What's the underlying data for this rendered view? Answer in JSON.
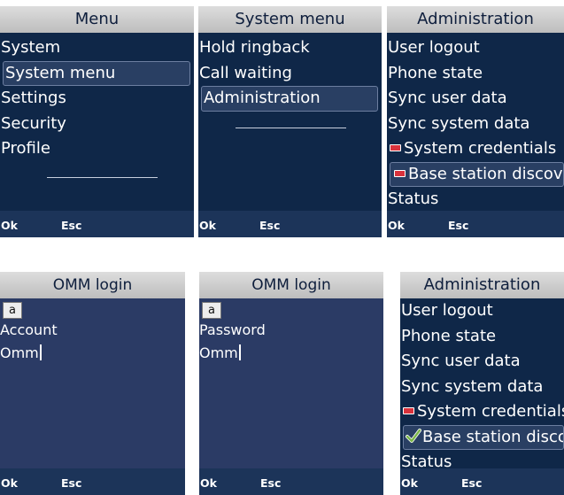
{
  "softkeys": {
    "ok": "Ok",
    "esc": "Esc"
  },
  "screens": {
    "menu": {
      "title": "Menu",
      "items": [
        "System",
        "System menu",
        "Settings",
        "Security",
        "Profile"
      ]
    },
    "system_menu": {
      "title": "System menu",
      "items": [
        "Hold ringback",
        "Call waiting",
        "Administration"
      ]
    },
    "administration_1": {
      "title": "Administration",
      "items": [
        "User logout",
        "Phone state",
        "Sync user data",
        "Sync system data",
        "System credentials",
        "Base station discovery",
        "Status"
      ]
    },
    "omm_login_account": {
      "title": "OMM login",
      "input_mode": "a",
      "label": "Account",
      "value": "Omm"
    },
    "omm_login_password": {
      "title": "OMM login",
      "input_mode": "a",
      "label": "Password",
      "value": "Omm"
    },
    "administration_2": {
      "title": "Administration",
      "items": [
        "User logout",
        "Phone state",
        "Sync user data",
        "Sync system data",
        "System credentials",
        "Base station discovery",
        "Status"
      ]
    }
  },
  "colors": {
    "screen_bg": "#0f2748",
    "login_bg": "#2b3b65",
    "title_bg": "#cccccc",
    "highlight_border": "#6c7ea0",
    "status_red": "#d9323c",
    "status_green": "#7ab648"
  },
  "icons": {
    "status_not_ok": "red-bar-icon",
    "status_ok": "green-check-icon"
  }
}
